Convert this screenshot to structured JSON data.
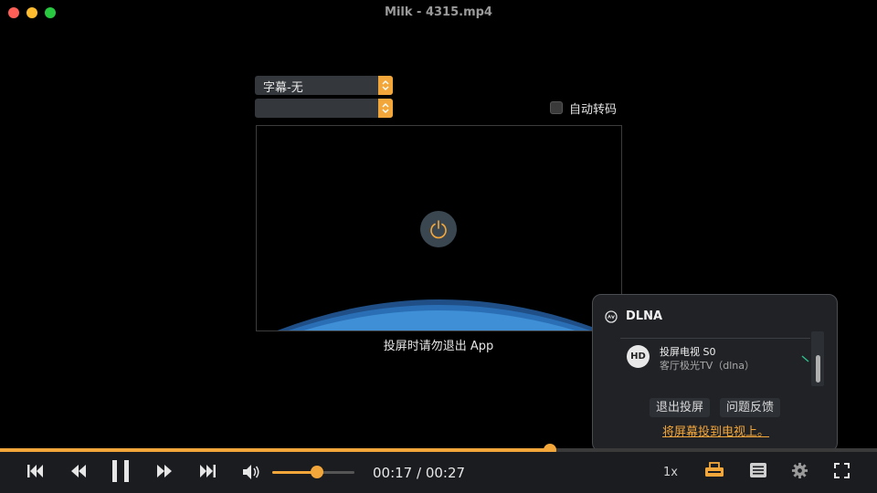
{
  "window": {
    "title": "Milk - 4315.mp4"
  },
  "subtitle_select": {
    "value": "字幕-无"
  },
  "audio_select": {
    "value": ""
  },
  "auto_transcode": {
    "label": "自动转码",
    "checked": false
  },
  "cast_note": "投屏时请勿退出 App",
  "dlna_panel": {
    "title": "DLNA",
    "device": {
      "badge": "HD",
      "name": "投屏电视 S0",
      "subtitle": "客厅极光TV（dlna）"
    },
    "exit_button": "退出投屏",
    "feedback_button": "问题反馈",
    "cast_link": "将屏幕投到电视上。"
  },
  "playback": {
    "current_time": "00:17",
    "total_time": "00:27",
    "time_display": "00:17 / 00:27",
    "progress_fraction": 0.627,
    "volume_fraction": 0.54,
    "speed": "1x",
    "state": "playing"
  },
  "colors": {
    "accent": "#f3a73b",
    "background": "#000000",
    "controlbar": "#1a1c20",
    "popup": "#202226"
  },
  "icons": [
    "skip-back-icon",
    "rewind-icon",
    "pause-icon",
    "fast-forward-icon",
    "skip-forward-icon",
    "volume-icon",
    "cast-icon",
    "playlist-icon",
    "gear-icon",
    "fullscreen-icon",
    "power-icon",
    "dlna-icon"
  ]
}
